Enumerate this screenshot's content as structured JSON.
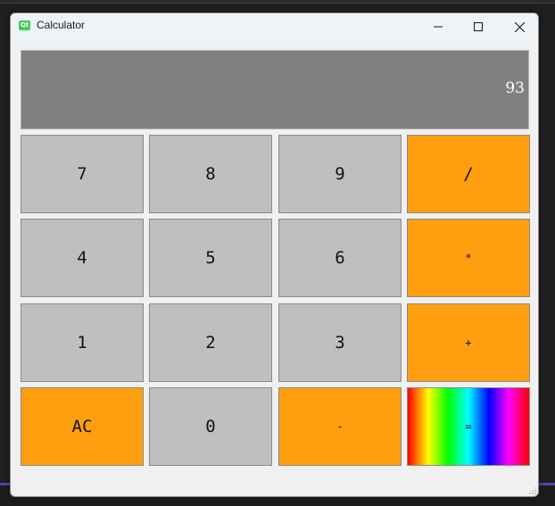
{
  "window": {
    "title": "Calculator",
    "icon_text": "Qt"
  },
  "display": {
    "value": "93"
  },
  "keys": {
    "k7": "7",
    "k8": "8",
    "k9": "9",
    "divide": "/",
    "k4": "4",
    "k5": "5",
    "k6": "6",
    "multiply": "*",
    "k1": "1",
    "k2": "2",
    "k3": "3",
    "add": "+",
    "clear": "AC",
    "k0": "0",
    "subtract": "-",
    "equals": "="
  },
  "colors": {
    "number_key": "#bfbfbf",
    "operator_key": "#ff9f10",
    "display_bg": "#808080",
    "display_text": "#ffffff"
  },
  "icons": {
    "app": "qt-logo-icon",
    "minimize": "minimize-icon",
    "maximize": "maximize-icon",
    "close": "close-icon"
  }
}
